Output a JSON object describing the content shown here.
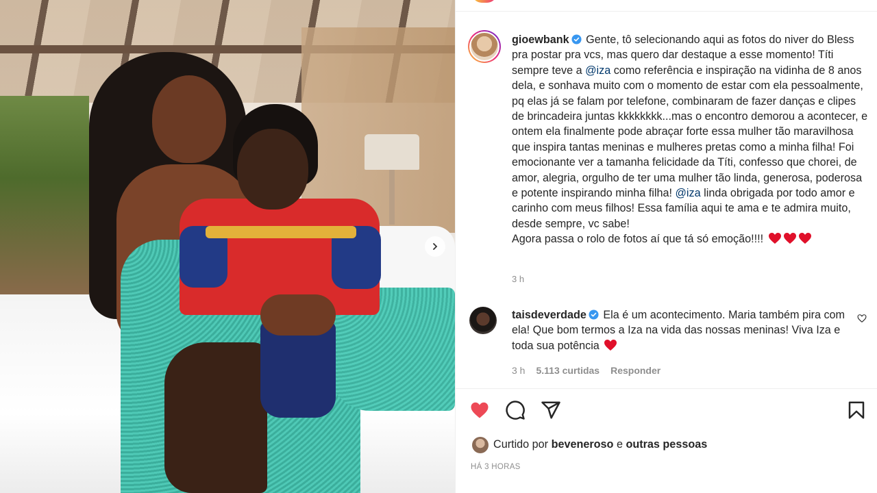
{
  "post": {
    "author": "gioewbank",
    "caption_lines": [
      "Gente, tô selecionando aqui as fotos do niver do",
      "Bless pra postar pra vcs, mas quero dar destaque a esse momento!"
    ],
    "caption_part1": "Títi sempre teve a ",
    "mention1": "@iza",
    "caption_part2": " como referência e inspiração na vidinha de 8 anos dela, e sonhava muito com o momento de estar com ela pessoalmente, pq elas já se falam por telefone, combinaram de fazer danças e clipes de brincadeira juntas kkkkkkkk...mas o encontro demorou a acontecer, e ontem ela finalmente pode abraçar forte essa mulher tão maravilhosa que inspira tantas meninas e mulheres pretas como a minha filha! Foi emocionante ver a tamanha felicidade da Títi, confesso que chorei, de amor, alegria, orgulho de ter uma mulher tão linda, generosa, poderosa e potente inspirando minha filha! ",
    "mention2": "@iza",
    "caption_part3": " linda obrigada por todo amor e carinho com meus filhos! Essa família aqui te ama e te admira muito, desde sempre, vc sabe!",
    "caption_last": "Agora passa o rolo de fotos aí que tá só emoção!!!! ",
    "time": "3 h"
  },
  "comment": {
    "author": "taisdeverdade",
    "text": "Ela é um acontecimento. Maria também pira com ela! Que bom termos a Iza na vida das nossas meninas! Viva Iza e toda sua potência ",
    "time": "3 h",
    "likes": "5.113 curtidas",
    "reply": "Responder"
  },
  "likes": {
    "prefix": "Curtido por ",
    "user": "beveneroso",
    "middle": " e ",
    "others": "outras pessoas"
  },
  "posted_ago": "HÁ 3 HORAS",
  "colors": {
    "like_red": "#ed4956",
    "link": "#00376b",
    "muted": "#8e8e8e",
    "verified": "#3897f0"
  },
  "icons": [
    "heart-icon",
    "comment-icon",
    "share-icon",
    "bookmark-icon",
    "verified-icon",
    "next-arrow-icon"
  ]
}
